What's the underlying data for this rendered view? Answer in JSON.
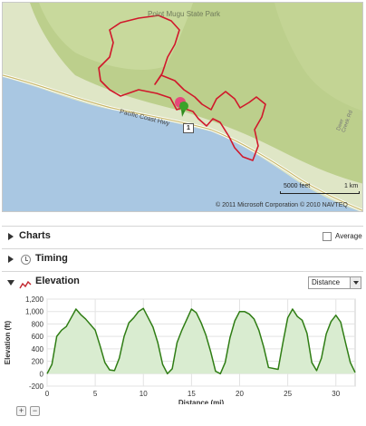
{
  "map": {
    "park_label": "Point Mugu State Park",
    "road_label": "Pacific Coast Hwy",
    "side_road_label": "Deer Creek Rd",
    "highway_shield": "1",
    "scale_feet": "5000 feet",
    "scale_km": "1 km",
    "copyright": "© 2011 Microsoft Corporation   © 2010 NAVTEQ",
    "colors": {
      "route": "#d0182b",
      "water": "#a9c7e2",
      "land": "#dfe6c6",
      "forest": "#bccf8c"
    }
  },
  "charts_panel": {
    "title": "Charts",
    "average_label": "Average",
    "average_checked": false
  },
  "timing_panel": {
    "title": "Timing"
  },
  "elevation_panel": {
    "title": "Elevation",
    "dropdown_selected": "Distance"
  },
  "chart_data": {
    "type": "area",
    "xlabel": "Distance (mi)",
    "ylabel": "Elevation (ft)",
    "xlim": [
      0,
      32
    ],
    "ylim": [
      -200,
      1200
    ],
    "xticks": [
      0,
      5,
      10,
      15,
      20,
      25,
      30
    ],
    "yticks": [
      -200,
      0,
      200,
      400,
      600,
      800,
      1000,
      1200
    ],
    "ytick_labels": [
      "-200",
      "0",
      "200",
      "400",
      "600",
      "800",
      "1,000",
      "1,200"
    ],
    "series": [
      {
        "x": [
          0,
          0.5,
          1,
          1.5,
          2,
          2.5,
          3,
          3.5,
          4,
          5,
          5.5,
          6,
          6.5,
          7,
          7.5,
          8,
          8.5,
          9,
          9.5,
          10,
          10.5,
          11,
          11.5,
          12,
          12.5,
          13,
          13.5,
          14,
          15,
          15.5,
          16,
          16.5,
          17,
          17.5,
          18,
          18.5,
          19,
          19.5,
          20,
          20.5,
          21,
          21.5,
          22,
          22.5,
          23,
          24,
          24.5,
          25,
          25.5,
          26,
          26.5,
          27,
          27.5,
          28,
          28.5,
          29,
          29.5,
          30,
          30.5,
          31,
          31.5,
          32
        ],
        "y": [
          0,
          150,
          600,
          700,
          760,
          900,
          1040,
          950,
          880,
          700,
          450,
          180,
          60,
          50,
          250,
          600,
          820,
          900,
          1000,
          1050,
          900,
          750,
          500,
          150,
          0,
          80,
          500,
          700,
          1040,
          980,
          820,
          620,
          350,
          40,
          0,
          180,
          580,
          850,
          1000,
          1000,
          960,
          880,
          700,
          430,
          100,
          70,
          500,
          900,
          1040,
          920,
          860,
          650,
          180,
          50,
          250,
          640,
          840,
          940,
          830,
          500,
          180,
          20
        ],
        "color": "#2f7d14",
        "fill": "#d9ecd0"
      }
    ]
  },
  "zoom": {
    "in": "+",
    "out": "−"
  }
}
